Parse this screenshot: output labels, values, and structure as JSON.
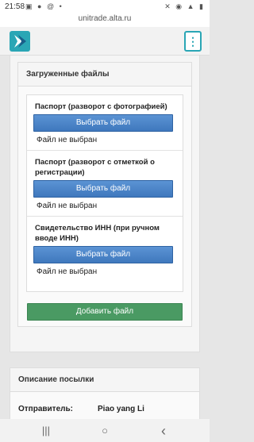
{
  "status_bar": {
    "time": "21:58",
    "left_icons": "▣ ● @ •",
    "right_icons": "✕ ◉ ▲ ▮"
  },
  "browser": {
    "url": "unitrade.alta.ru"
  },
  "header": {
    "logo_icon": "logo-icon",
    "menu_label": "⋮"
  },
  "files_section": {
    "title": "Загруженные файлы",
    "items": [
      {
        "label": "Паспорт (разворот с фотографией)",
        "button": "Выбрать файл",
        "status": "Файл не выбран"
      },
      {
        "label": "Паспорт (разворот с отметкой о регистрации)",
        "button": "Выбрать файл",
        "status": "Файл не выбран"
      },
      {
        "label": "Свидетельство ИНН (при ручном вводе ИНН)",
        "button": "Выбрать файл",
        "status": "Файл не выбран"
      }
    ],
    "add_button": "Добавить файл"
  },
  "parcel_section": {
    "title": "Описание посылки",
    "sender_label": "Отправитель:",
    "sender_value": "Piao yang Li"
  },
  "nav": {
    "recent": "|||",
    "home": "○",
    "back": "‹"
  },
  "colors": {
    "accent": "#2aa6b5",
    "choose_button": "#4a82c8",
    "add_button": "#4a9a63"
  }
}
